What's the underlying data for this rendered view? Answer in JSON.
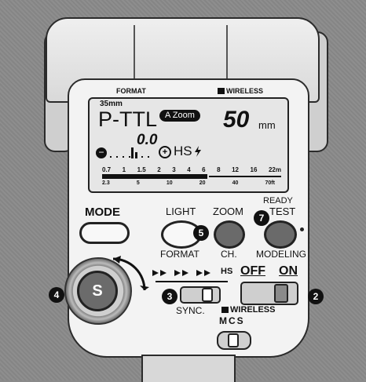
{
  "lcd": {
    "format_label": "FORMAT",
    "wireless_label": "WIRELESS",
    "focal_small": "35mm",
    "mode": "P-TTL",
    "zoom_badge": "A Zoom",
    "zoom_value": "50",
    "zoom_unit": "mm",
    "ev_value": "0.0",
    "hs_label": "HS",
    "scale_m": [
      "0.7",
      "1",
      "1.5",
      "2",
      "3",
      "4",
      "6",
      "8",
      "12",
      "16",
      "22m"
    ],
    "scale_ft": [
      "2.3",
      "5",
      "10",
      "20",
      "40",
      "70ft"
    ]
  },
  "buttons": {
    "mode": "MODE",
    "light": "LIGHT",
    "format": "FORMAT",
    "zoom": "ZOOM",
    "ch": "CH.",
    "ready": "READY",
    "test": "TEST",
    "modeling": "MODELING"
  },
  "controls": {
    "dial_letter": "S",
    "sync_modes": "HS",
    "off_label": "OFF",
    "on_label": "ON",
    "sync_label": "SYNC.",
    "wireless_label": "WIRELESS",
    "mcs_label": "MCS"
  },
  "markers": {
    "m2": "2",
    "m3": "3",
    "m4": "4",
    "m5": "5",
    "m7": "7"
  }
}
